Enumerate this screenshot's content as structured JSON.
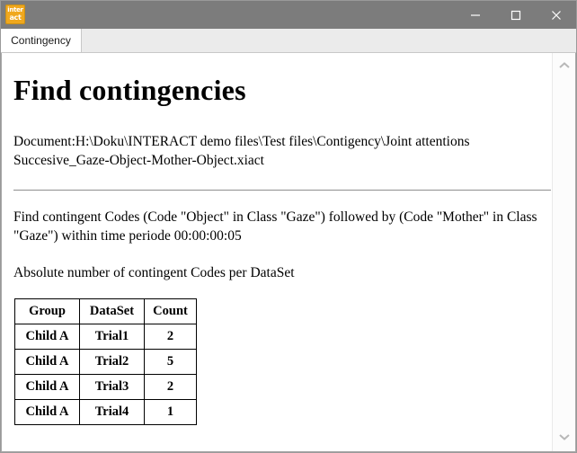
{
  "window": {
    "logo_line1": "inter",
    "logo_line2": "act",
    "controls": {
      "minimize": "minimize-icon",
      "maximize": "maximize-icon",
      "close": "close-icon"
    },
    "titlebar_color": "#7c7c7c"
  },
  "tabs": [
    {
      "label": "Contingency",
      "active": true
    }
  ],
  "document": {
    "heading": "Find contingencies",
    "path_line": "Document:H:\\Doku\\INTERACT demo files\\Test files\\Contigency\\Joint attentions Succesive_Gaze-Object-Mother-Object.xiact",
    "description": "Find contingent Codes (Code \"Object\" in Class \"Gaze\") followed by (Code \"Mother\" in Class \"Gaze\") within time periode 00:00:00:05",
    "subtitle": "Absolute number of contingent Codes per DataSet"
  },
  "table": {
    "headers": [
      "Group",
      "DataSet",
      "Count"
    ],
    "rows": [
      [
        "Child A",
        "Trial1",
        "2"
      ],
      [
        "Child A",
        "Trial2",
        "5"
      ],
      [
        "Child A",
        "Trial3",
        "2"
      ],
      [
        "Child A",
        "Trial4",
        "1"
      ]
    ]
  },
  "scrollbar": {
    "up_arrow": "chevron-up-icon",
    "down_arrow": "chevron-down-icon"
  }
}
